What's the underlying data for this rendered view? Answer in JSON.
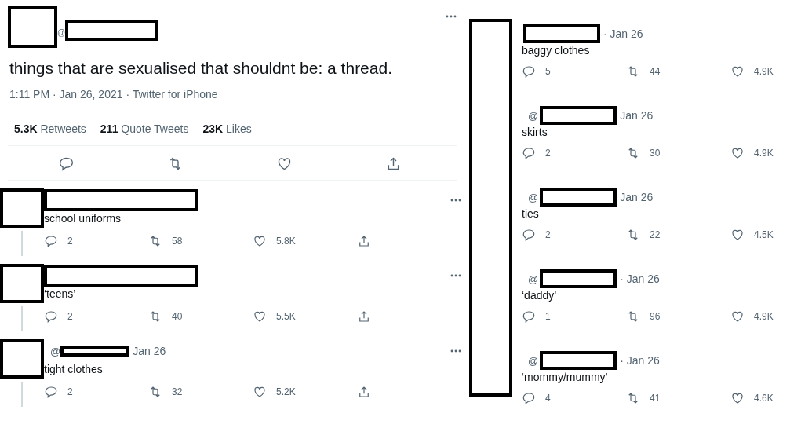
{
  "main_tweet": {
    "handle_prefix": "@",
    "text": "things that are sexualised that shouldnt be: a thread.",
    "meta": "1:11 PM · Jan 26, 2021 · Twitter for iPhone",
    "stats": [
      {
        "count": "5.3K",
        "label": "Retweets"
      },
      {
        "count": "211",
        "label": "Quote Tweets"
      },
      {
        "count": "23K",
        "label": "Likes"
      }
    ]
  },
  "replies": [
    {
      "text": "school uniforms",
      "replies": "2",
      "retweets": "58",
      "likes": "5.8K"
    },
    {
      "text": "‘teens’",
      "replies": "2",
      "retweets": "40",
      "likes": "5.5K"
    },
    {
      "handle_prefix": "@",
      "date": "Jan 26",
      "text": "tight clothes",
      "replies": "2",
      "retweets": "32",
      "likes": "5.2K"
    }
  ],
  "right_replies": [
    {
      "date": "· Jan 26",
      "text": "baggy clothes",
      "replies": "5",
      "retweets": "44",
      "likes": "4.9K"
    },
    {
      "handle_prefix": "@",
      "date": "Jan 26",
      "text": "skirts",
      "replies": "2",
      "retweets": "30",
      "likes": "4.9K"
    },
    {
      "handle_prefix": "@",
      "date": "Jan 26",
      "text": "ties",
      "replies": "2",
      "retweets": "22",
      "likes": "4.5K"
    },
    {
      "handle_prefix": "@",
      "date": "· Jan 26",
      "text": "‘daddy’",
      "replies": "1",
      "retweets": "96",
      "likes": "4.9K"
    },
    {
      "handle_prefix": "@",
      "date": "· Jan 26",
      "text": "‘mommy/mummy’",
      "replies": "4",
      "retweets": "41",
      "likes": "4.6K"
    }
  ]
}
